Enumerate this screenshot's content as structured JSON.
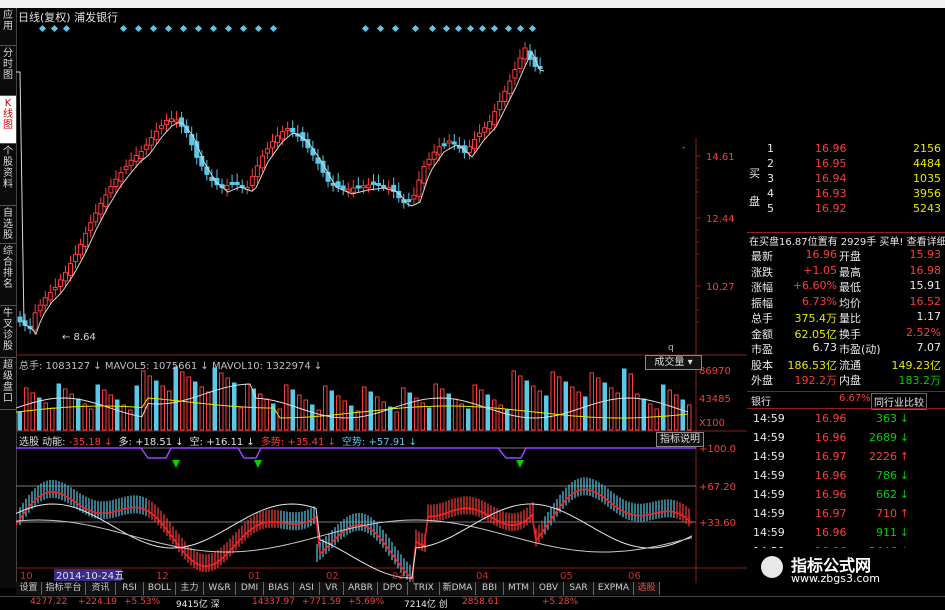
{
  "window": {
    "title": "日线(复权)  浦发银行"
  },
  "left_nav": [
    "应用",
    "分时图",
    "K线图",
    "个股资料",
    "自选股",
    "综合排名",
    "牛叉诊股",
    "超级盘口"
  ],
  "left_nav_active": 2,
  "price_axis": [
    "14.61",
    "12.44",
    "10.27"
  ],
  "low_marker": "8.64",
  "volume": {
    "header": "总手: 1083127 ↓  MAVOL5: 1075661 ↓  MAVOL10: 1322974 ↓",
    "button": "成交量",
    "axis": [
      "86970",
      "43485",
      "X100"
    ]
  },
  "indicator": {
    "header_name": "选股 动能: ",
    "header_vals": [
      {
        "text": "-35.18 ↓",
        "color": "#ff3c3c"
      },
      {
        "text": "多: +18.51 ↓",
        "color": "#e0e0e0"
      },
      {
        "text": "空: +16.11 ↓",
        "color": "#e0e0e0"
      },
      {
        "text": "多势: +35.41 ↓",
        "color": "#ff3c3c"
      },
      {
        "text": "空势: +57.91 ↓",
        "color": "#5ac8e8"
      }
    ],
    "button": "指标说明",
    "axis": [
      "100.0",
      "67.20",
      "33.60"
    ]
  },
  "time_axis": [
    "10",
    "2014-10-24五",
    "12",
    "01",
    "02",
    "03",
    "04",
    "05",
    "06"
  ],
  "bottom_tabs": [
    "设置",
    "指标平台",
    "资讯",
    "RSI",
    "BOLL",
    "主力",
    "W&R",
    "DMI",
    "BIAS",
    "ASI",
    "VR",
    "ARBR",
    "DPO",
    "TRIX",
    "新DMA",
    "BBI",
    "MTM",
    "OBV",
    "SAR",
    "EXPMA",
    "选股"
  ],
  "bottom_tab_active": 20,
  "status_bar": [
    {
      "text": "4277.22",
      "color": "#ff3c3c"
    },
    {
      "text": "+224.19",
      "color": "#ff3c3c"
    },
    {
      "text": "+5.53%",
      "color": "#ff3c3c"
    },
    {
      "text": "9415亿 深",
      "color": "#e8e8e8"
    },
    {
      "text": "14337.97",
      "color": "#ff3c3c"
    },
    {
      "text": "+771.59",
      "color": "#ff3c3c"
    },
    {
      "text": "+5.69%",
      "color": "#ff3c3c"
    },
    {
      "text": "7214亿 创",
      "color": "#e8e8e8"
    },
    {
      "text": "2858.61",
      "color": "#ff3c3c"
    },
    {
      "text": "+5.28%",
      "color": "#ff3c3c"
    }
  ],
  "order_book": {
    "side_label": "买盘",
    "rows": [
      {
        "level": "1",
        "price": "16.96",
        "vol": "2156"
      },
      {
        "level": "2",
        "price": "16.95",
        "vol": "4484"
      },
      {
        "level": "3",
        "price": "16.94",
        "vol": "1035"
      },
      {
        "level": "4",
        "price": "16.93",
        "vol": "3956"
      },
      {
        "level": "5",
        "price": "16.92",
        "vol": "5243"
      }
    ],
    "notice": "在买盘16.87位置有 2929手 买单! 查看详细"
  },
  "quote": [
    {
      "l1": "最新",
      "v1": "16.96",
      "l2": "开盘",
      "v2": "15.93"
    },
    {
      "l1": "涨跌",
      "v1": "+1.05",
      "l2": "最高",
      "v2": "16.98"
    },
    {
      "l1": "涨幅",
      "v1": "+6.60%",
      "l2": "最低",
      "v2": "15.91"
    },
    {
      "l1": "振幅",
      "v1": "6.73%",
      "l2": "均价",
      "v2": "16.52"
    },
    {
      "l1": "总手",
      "v1": "375.4万",
      "l2": "量比",
      "v2": "1.17"
    },
    {
      "l1": "金额",
      "v1": "62.05亿",
      "l2": "换手",
      "v2": "2.52%"
    },
    {
      "l1": "市盈",
      "v1": "6.73",
      "l2": "市盈(动)",
      "v2": "7.07"
    },
    {
      "l1": "股本",
      "v1": "186.53亿",
      "l2": "流通",
      "v2": "149.23亿"
    },
    {
      "l1": "外盘",
      "v1": "192.2万",
      "l2": "内盘",
      "v2": "183.2万"
    }
  ],
  "industry": {
    "name": "银行",
    "change": "6.67%",
    "button": "同行业比较"
  },
  "ticks": [
    {
      "time": "14:59",
      "price": "16.96",
      "vol": "363",
      "dir": "down"
    },
    {
      "time": "14:59",
      "price": "16.96",
      "vol": "2689",
      "dir": "down"
    },
    {
      "time": "14:59",
      "price": "16.97",
      "vol": "2226",
      "dir": "up"
    },
    {
      "time": "14:59",
      "price": "16.96",
      "vol": "786",
      "dir": "down"
    },
    {
      "time": "14:59",
      "price": "16.96",
      "vol": "662",
      "dir": "down"
    },
    {
      "time": "14:59",
      "price": "16.97",
      "vol": "710",
      "dir": "up"
    },
    {
      "time": "14:59",
      "price": "16.96",
      "vol": "911",
      "dir": "down"
    },
    {
      "time": "14:59",
      "price": "16.96",
      "vol": "3446",
      "dir": "down"
    }
  ],
  "watermark": {
    "title": "指标公式网",
    "url": "www.zbgs3.com"
  },
  "colors": {
    "up": "#ff3c3c",
    "down": "#5ac8e8",
    "green": "#00d000",
    "grid": "#8b2020"
  }
}
